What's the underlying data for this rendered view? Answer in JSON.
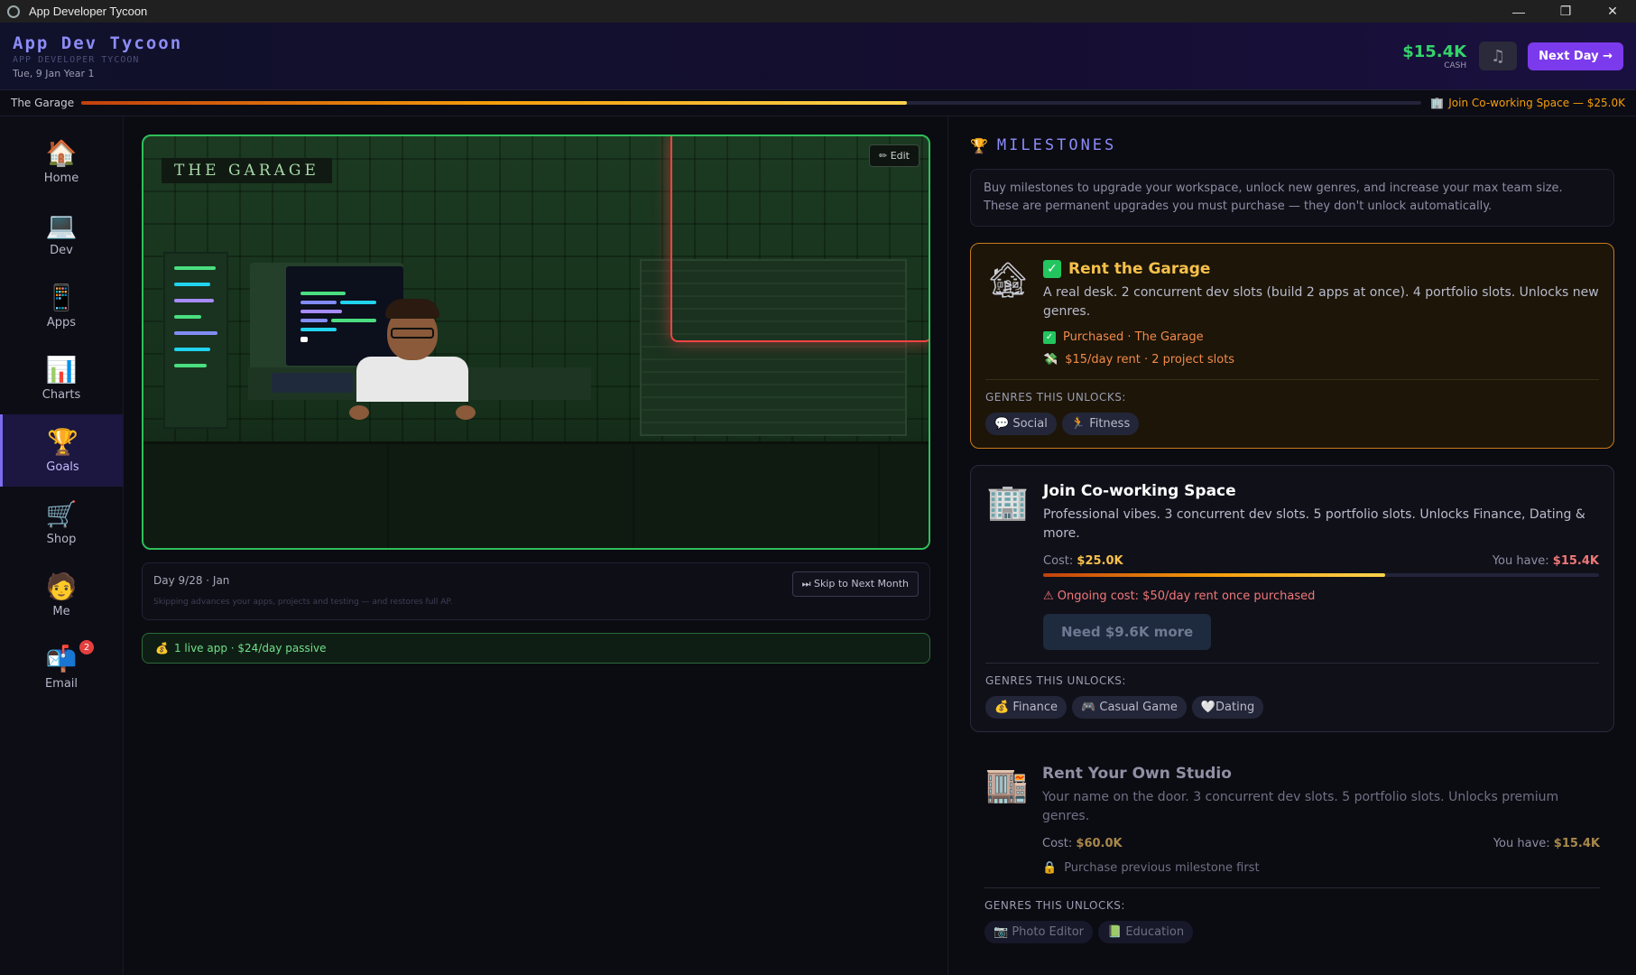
{
  "window": {
    "title": "App Developer Tycoon",
    "minimize": "—",
    "maximize": "❐",
    "close": "✕"
  },
  "header": {
    "title": "App Dev Tycoon",
    "subtitle": "APP DEVELOPER TYCOON",
    "date": "Tue, 9 Jan Year 1",
    "cash_value": "$15.4K",
    "cash_label": "CASH",
    "music_icon": "♫",
    "next_day_label": "Next Day →"
  },
  "progress": {
    "current": "The Garage",
    "next": "Join Co-working Space — $25.0K",
    "fraction": 0.616
  },
  "nav": [
    {
      "label": "Home",
      "icon": "🏠"
    },
    {
      "label": "Dev",
      "icon": "💻"
    },
    {
      "label": "Apps",
      "icon": "📱"
    },
    {
      "label": "Charts",
      "icon": "📊"
    },
    {
      "label": "Goals",
      "icon": "🏆"
    },
    {
      "label": "Shop",
      "icon": "🛒"
    },
    {
      "label": "Me",
      "icon": "🧑"
    },
    {
      "label": "Email",
      "icon": "📬",
      "badge": "2"
    }
  ],
  "scene": {
    "title": "THE GARAGE",
    "edit_label": "✏ Edit"
  },
  "day_panel": {
    "title": "Day 9/28 · Jan",
    "subtitle": "Skipping advances your apps, projects and testing — and restores full AP.",
    "skip_label": "⏭ Skip to Next Month"
  },
  "passive": {
    "icon": "💰",
    "text": "1 live app · $24/day passive"
  },
  "milestones": {
    "icon": "🏆",
    "title": "MILESTONES",
    "intro": "Buy milestones to upgrade your workspace, unlock new genres, and increase your max team size. These are permanent upgrades you must purchase — they don't unlock automatically.",
    "unlocks_label": "GENRES THIS UNLOCKS:",
    "cards": [
      {
        "icon": "🏚",
        "title": "Rent the Garage",
        "desc": "A real desk. 2 concurrent dev slots (build 2 apps at once). 4 portfolio slots. Unlocks new genres.",
        "status1": "Purchased · The Garage",
        "status2": "$15/day rent · 2 project slots",
        "chips": [
          "💬 Social",
          "🏃 Fitness"
        ]
      },
      {
        "icon": "🏢",
        "title": "Join Co-working Space",
        "desc": "Professional vibes. 3 concurrent dev slots. 5 portfolio slots. Unlocks Finance, Dating & more.",
        "cost_label": "Cost: ",
        "cost": "$25.0K",
        "have_label": "You have: ",
        "have": "$15.4K",
        "fraction": 0.616,
        "warning": "⚠ Ongoing cost: $50/day rent once purchased",
        "need_label": "Need $9.6K more",
        "chips": [
          "💰 Finance",
          "🎮 Casual Game",
          "🤍Dating"
        ]
      },
      {
        "icon": "🏬",
        "title": "Rent Your Own Studio",
        "desc": "Your name on the door. 3 concurrent dev slots. 5 portfolio slots. Unlocks premium genres.",
        "cost_label": "Cost: ",
        "cost": "$60.0K",
        "have_label": "You have: ",
        "have": "$15.4K",
        "lock_icon": "🔒",
        "lock_text": "Purchase previous milestone first",
        "chips": [
          "📷 Photo Editor",
          "📗 Education"
        ]
      }
    ]
  }
}
